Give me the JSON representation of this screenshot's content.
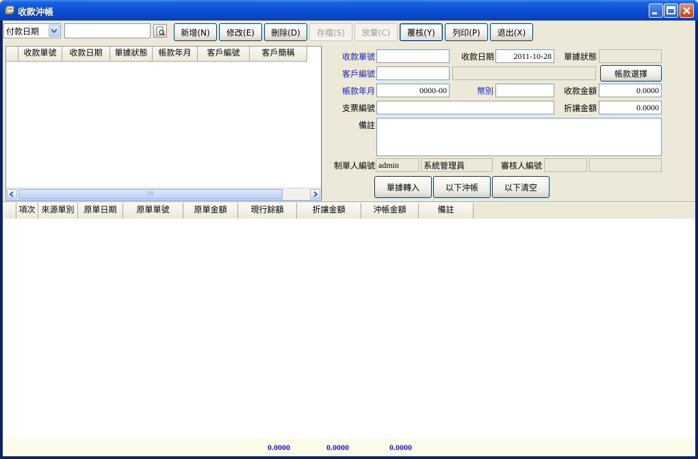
{
  "window": {
    "title": "收款沖帳"
  },
  "toolbar": {
    "filter_select": "付款日期",
    "search_value": "",
    "buttons": [
      {
        "label": "新增(N)",
        "enabled": true
      },
      {
        "label": "修改(E)",
        "enabled": true
      },
      {
        "label": "刪除(D)",
        "enabled": true
      },
      {
        "label": "存檔(S)",
        "enabled": false
      },
      {
        "label": "放棄(C)",
        "enabled": false
      },
      {
        "label": "覆核(Y)",
        "enabled": true
      },
      {
        "label": "列印(P)",
        "enabled": true
      },
      {
        "label": "退出(X)",
        "enabled": true
      }
    ]
  },
  "list_grid": {
    "columns": [
      "收款單號",
      "收款日期",
      "單據狀態",
      "帳款年月",
      "客戶編號",
      "客戶簡稱"
    ],
    "rows": []
  },
  "form": {
    "receipt_no": {
      "label": "收款單號",
      "value": ""
    },
    "receipt_date": {
      "label": "收款日期",
      "value": "2011-10-28"
    },
    "doc_status": {
      "label": "單據狀態",
      "value": ""
    },
    "customer_no": {
      "label": "客戶編號",
      "value": "",
      "name_value": ""
    },
    "account_select_button": "帳款選擇",
    "account_period": {
      "label": "帳款年月",
      "value": "0000-00"
    },
    "currency": {
      "label": "幣別",
      "value": ""
    },
    "receipt_amount": {
      "label": "收款金額",
      "value": "0.0000"
    },
    "check_no": {
      "label": "支票編號",
      "value": ""
    },
    "discount_amount": {
      "label": "折讓金額",
      "value": "0.0000"
    },
    "remarks": {
      "label": "備註",
      "value": ""
    },
    "creator": {
      "label": "制單人編號",
      "id": "admin",
      "name": "系統管理員"
    },
    "reviewer": {
      "label": "審核人編號",
      "id": "",
      "name": ""
    },
    "action_buttons": [
      "單據轉入",
      "以下沖帳",
      "以下清空"
    ]
  },
  "detail_grid": {
    "columns": [
      "項次",
      "來源單別",
      "原單日期",
      "原單單號",
      "原單金額",
      "現行餘額",
      "折讓金額",
      "沖帳金額",
      "備註"
    ],
    "rows": [],
    "totals": {
      "current_balance": "0.0000",
      "discount": "0.0000",
      "offset": "0.0000"
    }
  },
  "colors": {
    "title_bar": "#0a4fd6",
    "label_blue": "#1a1adc",
    "face": "#ece9d8"
  }
}
